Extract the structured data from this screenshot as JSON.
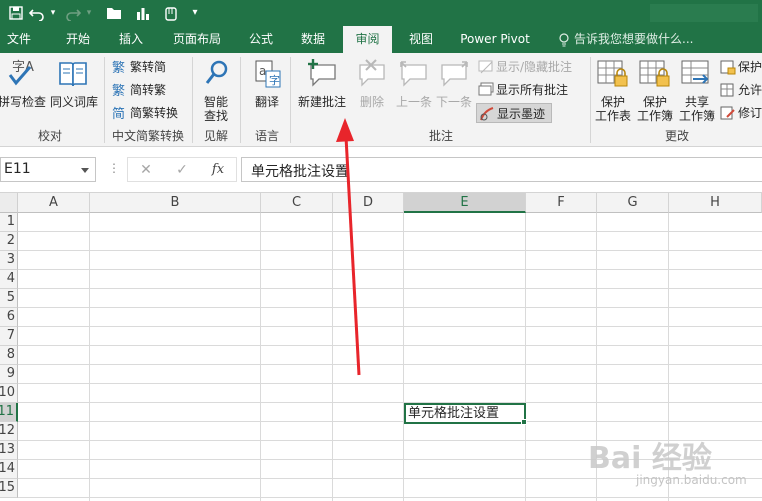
{
  "titlebar": {
    "undo_icon": "undo-icon",
    "redo_icon": "redo-icon",
    "open_icon": "open-folder-icon",
    "chart_icon": "bar-chart-icon",
    "touch_icon": "touch-mode-icon",
    "customize_icon": "customize-qat-icon"
  },
  "tabs": [
    {
      "label": "文件",
      "active": false
    },
    {
      "label": "开始",
      "active": false
    },
    {
      "label": "插入",
      "active": false
    },
    {
      "label": "页面布局",
      "active": false
    },
    {
      "label": "公式",
      "active": false
    },
    {
      "label": "数据",
      "active": false
    },
    {
      "label": "审阅",
      "active": true
    },
    {
      "label": "视图",
      "active": false
    },
    {
      "label": "Power Pivot",
      "active": false
    }
  ],
  "tell_me": "告诉我您想要做什么...",
  "ribbon": {
    "proofing": {
      "spell_check": "拼写检查",
      "thesaurus": "同义词库",
      "group": "校对"
    },
    "chinese": {
      "trad_to_simp": "繁转简",
      "simp_to_trad": "简转繁",
      "convert": "简繁转换",
      "group": "中文简繁转换"
    },
    "insights": {
      "smart_lookup_1": "智能",
      "smart_lookup_2": "查找",
      "group": "见解"
    },
    "language": {
      "translate": "翻译",
      "group": "语言"
    },
    "comments": {
      "new_comment": "新建批注",
      "delete": "删除",
      "previous": "上一条",
      "next": "下一条",
      "show_hide": "显示/隐藏批注",
      "show_all": "显示所有批注",
      "show_ink": "显示墨迹",
      "group": "批注"
    },
    "changes": {
      "protect_sheet_1": "保护",
      "protect_sheet_2": "工作表",
      "protect_workbook_1": "保护",
      "protect_workbook_2": "工作簿",
      "share_workbook_1": "共享",
      "share_workbook_2": "工作簿",
      "protect_share": "保护",
      "allow_edit": "允许",
      "track_changes": "修订",
      "group": "更改"
    }
  },
  "formula_bar": {
    "name_box": "E11",
    "fx": "fx",
    "cancel": "✕",
    "enter": "✓",
    "content": "单元格批注设置"
  },
  "grid": {
    "columns": [
      "A",
      "B",
      "C",
      "D",
      "E",
      "F",
      "G",
      "H"
    ],
    "selected_column": "E",
    "rows": [
      "1",
      "2",
      "3",
      "4",
      "5",
      "6",
      "7",
      "8",
      "9",
      "10",
      "11",
      "12",
      "13",
      "14",
      "15"
    ],
    "selected_row": "11",
    "active_cell_text": "单元格批注设置"
  },
  "watermark": {
    "main": "Bai 经验",
    "sub": "jingyan.baidu.com"
  },
  "colors": {
    "excel_green": "#217346",
    "ribbon_bg": "#f3f3f3",
    "arrow_red": "#e8252b"
  }
}
